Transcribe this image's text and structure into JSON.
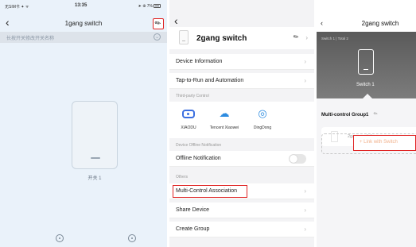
{
  "colors": {
    "highlight": "#e02424",
    "accent": "#2c8be0",
    "link": "#f1b08a"
  },
  "panel1": {
    "status": {
      "carrier": "无SIM卡 ✦ ᯤ",
      "time": "13:35",
      "right": "➤ ⊕ 7%"
    },
    "back_icon": "chevron-left-icon",
    "title": "1gang switch",
    "edit_icon": "pencil-icon",
    "banner_hint": "长按开关修改开关名称",
    "switch_label": "开关 1",
    "bottom_icons": [
      "clock-icon",
      "timer-icon"
    ]
  },
  "panel2": {
    "back_icon": "chevron-left-icon",
    "device_name": "2gang switch",
    "rows_top": [
      "Device Information",
      "Tap-to-Run and Automation"
    ],
    "third_party_section": "Third-party Control",
    "third_party": [
      {
        "name": "XIAODU",
        "icon": "xiaodu-icon"
      },
      {
        "name": "Tencent Xiaowei",
        "icon": "cloud-icon"
      },
      {
        "name": "DingDong",
        "icon": "dingdong-icon"
      }
    ],
    "offline_section": "Device Offline Notification",
    "offline_label": "Offline Notification",
    "others_section": "Others",
    "rows_bottom": [
      "Multi-Control Association",
      "Share Device",
      "Create Group"
    ]
  },
  "panel3": {
    "title": "2gang switch",
    "subtitle": "Switch 1 | Total 2",
    "switch_label": "Switch 1",
    "group_label": "Multi-control Group1",
    "device_name": "2gang switch",
    "link_label": "+  Link with Switch"
  }
}
